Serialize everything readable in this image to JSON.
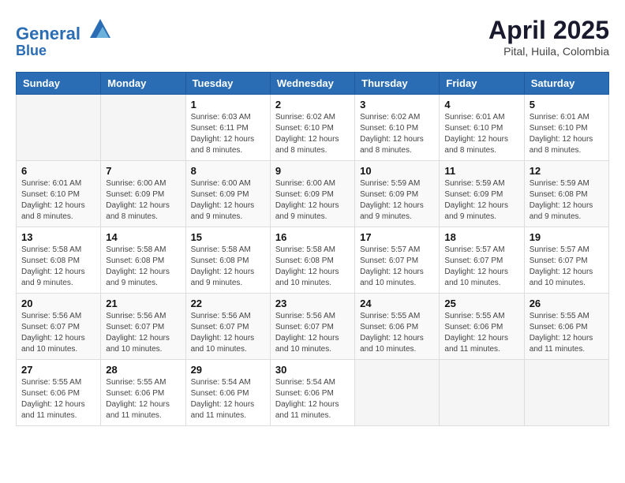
{
  "header": {
    "logo_line1": "General",
    "logo_line2": "Blue",
    "title": "April 2025",
    "subtitle": "Pital, Huila, Colombia"
  },
  "weekdays": [
    "Sunday",
    "Monday",
    "Tuesday",
    "Wednesday",
    "Thursday",
    "Friday",
    "Saturday"
  ],
  "weeks": [
    [
      {
        "day": "",
        "info": ""
      },
      {
        "day": "",
        "info": ""
      },
      {
        "day": "1",
        "info": "Sunrise: 6:03 AM\nSunset: 6:11 PM\nDaylight: 12 hours\nand 8 minutes."
      },
      {
        "day": "2",
        "info": "Sunrise: 6:02 AM\nSunset: 6:10 PM\nDaylight: 12 hours\nand 8 minutes."
      },
      {
        "day": "3",
        "info": "Sunrise: 6:02 AM\nSunset: 6:10 PM\nDaylight: 12 hours\nand 8 minutes."
      },
      {
        "day": "4",
        "info": "Sunrise: 6:01 AM\nSunset: 6:10 PM\nDaylight: 12 hours\nand 8 minutes."
      },
      {
        "day": "5",
        "info": "Sunrise: 6:01 AM\nSunset: 6:10 PM\nDaylight: 12 hours\nand 8 minutes."
      }
    ],
    [
      {
        "day": "6",
        "info": "Sunrise: 6:01 AM\nSunset: 6:10 PM\nDaylight: 12 hours\nand 8 minutes."
      },
      {
        "day": "7",
        "info": "Sunrise: 6:00 AM\nSunset: 6:09 PM\nDaylight: 12 hours\nand 8 minutes."
      },
      {
        "day": "8",
        "info": "Sunrise: 6:00 AM\nSunset: 6:09 PM\nDaylight: 12 hours\nand 9 minutes."
      },
      {
        "day": "9",
        "info": "Sunrise: 6:00 AM\nSunset: 6:09 PM\nDaylight: 12 hours\nand 9 minutes."
      },
      {
        "day": "10",
        "info": "Sunrise: 5:59 AM\nSunset: 6:09 PM\nDaylight: 12 hours\nand 9 minutes."
      },
      {
        "day": "11",
        "info": "Sunrise: 5:59 AM\nSunset: 6:09 PM\nDaylight: 12 hours\nand 9 minutes."
      },
      {
        "day": "12",
        "info": "Sunrise: 5:59 AM\nSunset: 6:08 PM\nDaylight: 12 hours\nand 9 minutes."
      }
    ],
    [
      {
        "day": "13",
        "info": "Sunrise: 5:58 AM\nSunset: 6:08 PM\nDaylight: 12 hours\nand 9 minutes."
      },
      {
        "day": "14",
        "info": "Sunrise: 5:58 AM\nSunset: 6:08 PM\nDaylight: 12 hours\nand 9 minutes."
      },
      {
        "day": "15",
        "info": "Sunrise: 5:58 AM\nSunset: 6:08 PM\nDaylight: 12 hours\nand 9 minutes."
      },
      {
        "day": "16",
        "info": "Sunrise: 5:58 AM\nSunset: 6:08 PM\nDaylight: 12 hours\nand 10 minutes."
      },
      {
        "day": "17",
        "info": "Sunrise: 5:57 AM\nSunset: 6:07 PM\nDaylight: 12 hours\nand 10 minutes."
      },
      {
        "day": "18",
        "info": "Sunrise: 5:57 AM\nSunset: 6:07 PM\nDaylight: 12 hours\nand 10 minutes."
      },
      {
        "day": "19",
        "info": "Sunrise: 5:57 AM\nSunset: 6:07 PM\nDaylight: 12 hours\nand 10 minutes."
      }
    ],
    [
      {
        "day": "20",
        "info": "Sunrise: 5:56 AM\nSunset: 6:07 PM\nDaylight: 12 hours\nand 10 minutes."
      },
      {
        "day": "21",
        "info": "Sunrise: 5:56 AM\nSunset: 6:07 PM\nDaylight: 12 hours\nand 10 minutes."
      },
      {
        "day": "22",
        "info": "Sunrise: 5:56 AM\nSunset: 6:07 PM\nDaylight: 12 hours\nand 10 minutes."
      },
      {
        "day": "23",
        "info": "Sunrise: 5:56 AM\nSunset: 6:07 PM\nDaylight: 12 hours\nand 10 minutes."
      },
      {
        "day": "24",
        "info": "Sunrise: 5:55 AM\nSunset: 6:06 PM\nDaylight: 12 hours\nand 10 minutes."
      },
      {
        "day": "25",
        "info": "Sunrise: 5:55 AM\nSunset: 6:06 PM\nDaylight: 12 hours\nand 11 minutes."
      },
      {
        "day": "26",
        "info": "Sunrise: 5:55 AM\nSunset: 6:06 PM\nDaylight: 12 hours\nand 11 minutes."
      }
    ],
    [
      {
        "day": "27",
        "info": "Sunrise: 5:55 AM\nSunset: 6:06 PM\nDaylight: 12 hours\nand 11 minutes."
      },
      {
        "day": "28",
        "info": "Sunrise: 5:55 AM\nSunset: 6:06 PM\nDaylight: 12 hours\nand 11 minutes."
      },
      {
        "day": "29",
        "info": "Sunrise: 5:54 AM\nSunset: 6:06 PM\nDaylight: 12 hours\nand 11 minutes."
      },
      {
        "day": "30",
        "info": "Sunrise: 5:54 AM\nSunset: 6:06 PM\nDaylight: 12 hours\nand 11 minutes."
      },
      {
        "day": "",
        "info": ""
      },
      {
        "day": "",
        "info": ""
      },
      {
        "day": "",
        "info": ""
      }
    ]
  ]
}
